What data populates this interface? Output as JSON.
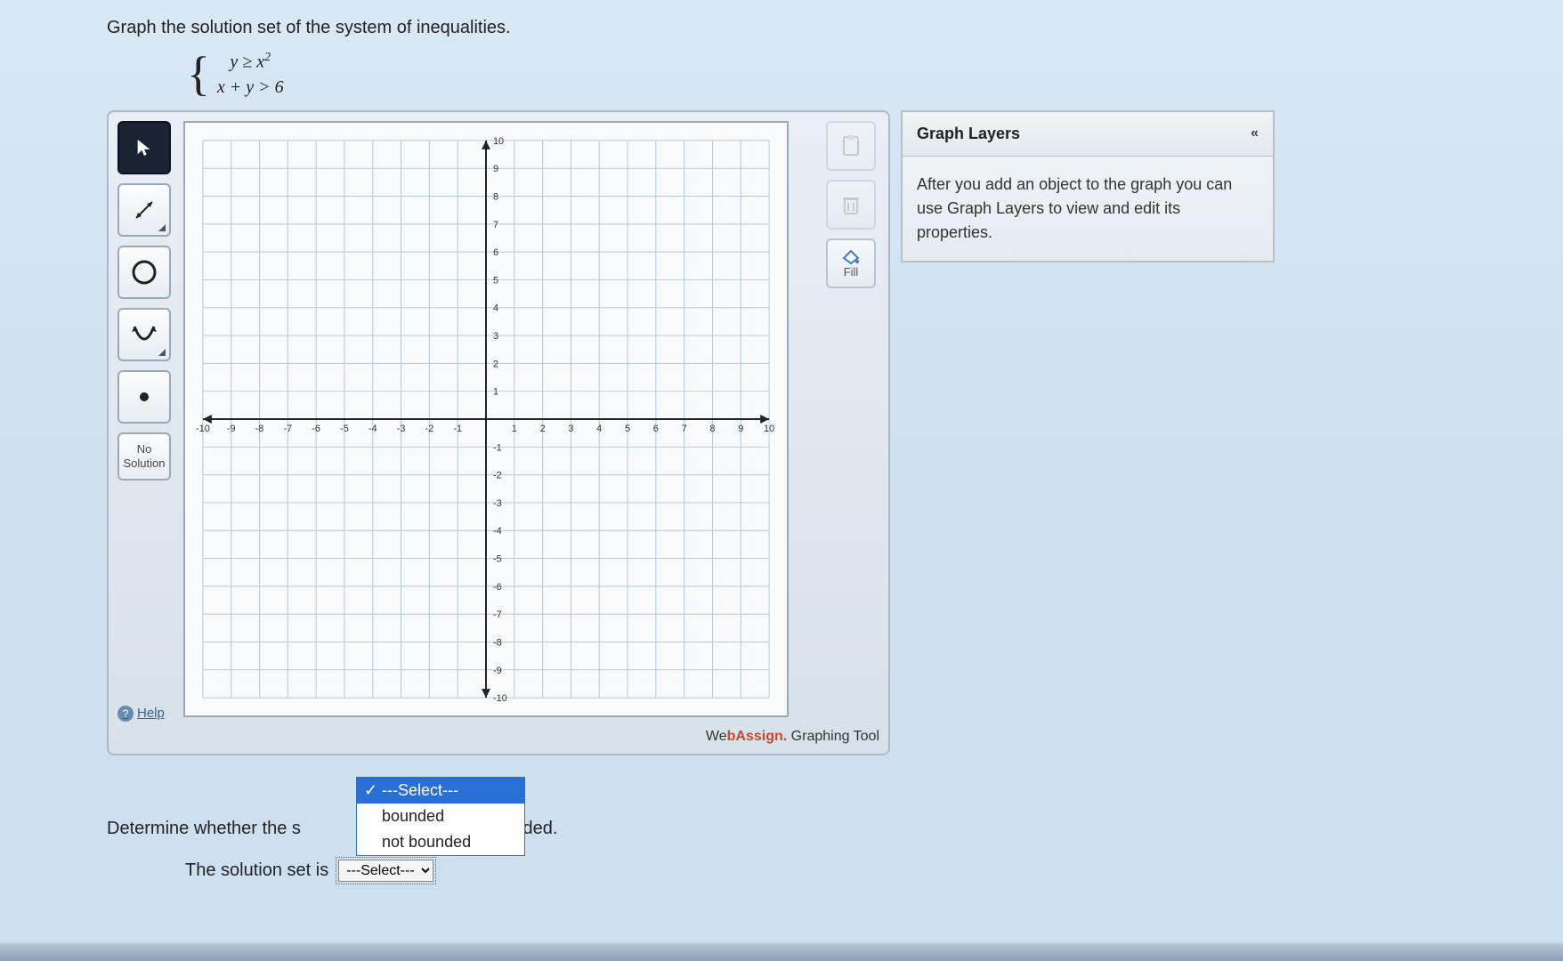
{
  "prompt": "Graph the solution set of the system of inequalities.",
  "system": {
    "eq1_lhs": "y",
    "eq1_op": "≥",
    "eq1_rhs_base": "x",
    "eq1_rhs_exp": "2",
    "eq2": "x + y > 6"
  },
  "tools": {
    "no_solution_line1": "No",
    "no_solution_line2": "Solution",
    "help": "Help"
  },
  "right_tools": {
    "fill": "Fill"
  },
  "graph": {
    "xmin": -10,
    "xmax": 10,
    "ymin": -10,
    "ymax": 10,
    "ticks": [
      -10,
      -9,
      -8,
      -7,
      -6,
      -5,
      -4,
      -3,
      -2,
      -1,
      1,
      2,
      3,
      4,
      5,
      6,
      7,
      8,
      9,
      10
    ]
  },
  "footer": {
    "brand_pre": "We",
    "brand_b": "b",
    "brand_assign": "Assign.",
    "tool_label": " Graphing Tool"
  },
  "layers": {
    "title": "Graph Layers",
    "collapse": "«",
    "body": "After you add an object to the graph you can use Graph Layers to view and edit its properties."
  },
  "dropdown": {
    "opt_placeholder": "---Select---",
    "opt1": "bounded",
    "opt2": "not bounded"
  },
  "determine": {
    "prefix": "Determine whether the s",
    "suffix": "ded."
  },
  "solution_line": {
    "label": "The solution set is",
    "select_placeholder": "---Select---"
  },
  "chart_data": {
    "type": "scatter",
    "title": "",
    "xlabel": "",
    "ylabel": "",
    "xlim": [
      -10,
      10
    ],
    "ylim": [
      -10,
      10
    ],
    "grid": true,
    "series": []
  }
}
